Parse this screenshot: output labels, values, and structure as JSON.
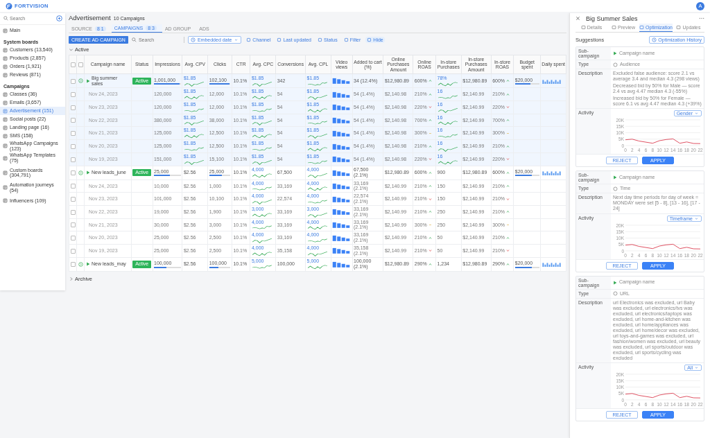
{
  "topbar": {
    "brand": "FORTVISION",
    "avatar": "A"
  },
  "sidebar": {
    "search": {
      "placeholder": "Search"
    },
    "sections": [
      {
        "items": [
          {
            "label": "Main",
            "selected": false
          }
        ]
      },
      {
        "title": "System boards",
        "items": [
          {
            "label": "Customers (13,540)",
            "selected": false
          },
          {
            "label": "Products (2,857)",
            "selected": false
          },
          {
            "label": "Orders (1,921)",
            "selected": false
          },
          {
            "label": "Reviews (871)",
            "selected": false
          }
        ]
      },
      {
        "title": "Campaigns",
        "items": [
          {
            "label": "Classes (36)",
            "selected": false
          },
          {
            "label": "Emails (3,657)",
            "selected": false
          },
          {
            "label": "Advertisement (151)",
            "selected": true
          },
          {
            "label": "Social posts (22)",
            "selected": false
          },
          {
            "label": "Landing page (16)",
            "selected": false
          },
          {
            "label": "SMS (158)",
            "selected": false
          },
          {
            "label": "WhatsApp Campaigns (123)",
            "selected": false
          },
          {
            "label": "WhatsApp Templates (75)",
            "selected": false
          }
        ]
      },
      {
        "items": [
          {
            "label": "Custom boards (304,791)",
            "selected": false
          }
        ]
      },
      {
        "items": [
          {
            "label": "Automation journeys (54)",
            "selected": false
          }
        ]
      },
      {
        "items": [
          {
            "label": "Influencers (109)",
            "selected": false
          }
        ]
      }
    ]
  },
  "header": {
    "title": "Advertisement",
    "count": "10 Campaigns"
  },
  "tabs": [
    {
      "label": "SOURCE",
      "badge": "8 1",
      "selected": false
    },
    {
      "label": "CAMPAIGNS",
      "badge": "8 3",
      "selected": true
    },
    {
      "label": "AD GROUP",
      "selected": false
    },
    {
      "label": "ADS",
      "selected": false
    }
  ],
  "toolbar": {
    "create": "CREATE AD CAMPAIGN",
    "search": {
      "placeholder": "Search"
    },
    "date": "Embedded date",
    "actions": [
      "Channel",
      "Last updated",
      "Status",
      "Filter",
      "Hide"
    ]
  },
  "groups": [
    {
      "label": "Active",
      "expanded": true
    },
    {
      "label": "Archive",
      "expanded": false
    }
  ],
  "table": {
    "header_checks": [
      {
        "checked": false
      },
      {
        "checked": false
      }
    ],
    "columns": [
      "Campaign name",
      "Status",
      "Impressions",
      "Avg. CPV",
      "Clicks",
      "CTR",
      "Avg. CPC",
      "Conversions",
      "Avg. CPL",
      "Video views",
      "Added to cart (%)",
      "Online Purchases Amount",
      "Online ROAS",
      "In-store Purchases",
      "In-store Purchases Amount",
      "In-store ROAS",
      "Budget spent",
      "Daily spent"
    ],
    "rows": [
      {
        "kind": "campaign",
        "selected": true,
        "checked": false,
        "cells": [
          {
            "kind": "name",
            "text": "Big summer sales"
          },
          {
            "kind": "status",
            "text": "Active"
          },
          {
            "kind": "progress",
            "text": "1,001,000",
            "level": 0.95
          },
          {
            "kind": "spark",
            "text": "$1.85"
          },
          {
            "kind": "progress",
            "text": "102,100",
            "level": 0.95
          },
          {
            "kind": "text",
            "text": "10.1%"
          },
          {
            "kind": "spark",
            "text": "$1.85"
          },
          {
            "kind": "text",
            "text": "342"
          },
          {
            "kind": "spark",
            "text": "$1.85"
          },
          {
            "kind": "bars"
          },
          {
            "kind": "text",
            "text": "34 (12.4%)"
          },
          {
            "kind": "text",
            "text": "$12,980.89"
          },
          {
            "kind": "trend_up",
            "text": "600%"
          },
          {
            "kind": "spark",
            "text": "78%"
          },
          {
            "kind": "text",
            "text": "$12,980.89"
          },
          {
            "kind": "trend_up",
            "text": "600%"
          },
          {
            "kind": "budget",
            "text": "$20,000",
            "level": 0.65
          },
          {
            "kind": "daily"
          }
        ]
      },
      {
        "kind": "day",
        "selected": true,
        "checked": false,
        "cells": [
          {
            "kind": "date",
            "text": "Nov 24, 2023"
          },
          {
            "kind": "blank"
          },
          {
            "kind": "text",
            "text": "120,000"
          },
          {
            "kind": "spark",
            "text": "$1.85"
          },
          {
            "kind": "text",
            "text": "12,000"
          },
          {
            "kind": "text",
            "text": "10.1%"
          },
          {
            "kind": "spark",
            "text": "$1.85"
          },
          {
            "kind": "text",
            "text": "54"
          },
          {
            "kind": "spark",
            "text": "$1.85"
          },
          {
            "kind": "bars"
          },
          {
            "kind": "text",
            "text": "54 (1.4%)"
          },
          {
            "kind": "text",
            "text": "$2,140.98"
          },
          {
            "kind": "trend_up",
            "text": "210%"
          },
          {
            "kind": "spark",
            "text": "16"
          },
          {
            "kind": "text",
            "text": "$2,140.99"
          },
          {
            "kind": "trend_up",
            "text": "210%"
          },
          {
            "kind": "blank"
          },
          {
            "kind": "blank"
          }
        ]
      },
      {
        "kind": "day",
        "selected": true,
        "checked": false,
        "cells": [
          {
            "kind": "date",
            "text": "Nov 23, 2023"
          },
          {
            "kind": "blank"
          },
          {
            "kind": "text",
            "text": "120,000"
          },
          {
            "kind": "spark",
            "text": "$1.85"
          },
          {
            "kind": "text",
            "text": "12,000"
          },
          {
            "kind": "text",
            "text": "10.1%"
          },
          {
            "kind": "spark",
            "text": "$1.85"
          },
          {
            "kind": "text",
            "text": "54"
          },
          {
            "kind": "spark",
            "text": "$1.85"
          },
          {
            "kind": "bars"
          },
          {
            "kind": "text",
            "text": "54 (1.4%)"
          },
          {
            "kind": "text",
            "text": "$2,140.98"
          },
          {
            "kind": "trend_down",
            "text": "220%"
          },
          {
            "kind": "spark",
            "text": "16"
          },
          {
            "kind": "text",
            "text": "$2,140.99"
          },
          {
            "kind": "trend_down",
            "text": "220%"
          },
          {
            "kind": "blank"
          },
          {
            "kind": "blank"
          }
        ]
      },
      {
        "kind": "day",
        "selected": true,
        "checked": false,
        "cells": [
          {
            "kind": "date",
            "text": "Nov 22, 2023"
          },
          {
            "kind": "blank"
          },
          {
            "kind": "text",
            "text": "380,000"
          },
          {
            "kind": "spark",
            "text": "$1.85"
          },
          {
            "kind": "text",
            "text": "38,000"
          },
          {
            "kind": "text",
            "text": "10.1%"
          },
          {
            "kind": "spark",
            "text": "$1.85"
          },
          {
            "kind": "text",
            "text": "54"
          },
          {
            "kind": "spark",
            "text": "$1.85"
          },
          {
            "kind": "bars"
          },
          {
            "kind": "text",
            "text": "54 (1.4%)"
          },
          {
            "kind": "text",
            "text": "$2,140.98"
          },
          {
            "kind": "trend_up",
            "text": "700%"
          },
          {
            "kind": "spark",
            "text": "16"
          },
          {
            "kind": "text",
            "text": "$2,140.99"
          },
          {
            "kind": "trend_up",
            "text": "700%"
          },
          {
            "kind": "blank"
          },
          {
            "kind": "blank"
          }
        ]
      },
      {
        "kind": "day",
        "selected": true,
        "checked": false,
        "cells": [
          {
            "kind": "date",
            "text": "Nov 21, 2023"
          },
          {
            "kind": "blank"
          },
          {
            "kind": "text",
            "text": "125,000"
          },
          {
            "kind": "spark",
            "text": "$1.85"
          },
          {
            "kind": "text",
            "text": "12,500"
          },
          {
            "kind": "text",
            "text": "10.1%"
          },
          {
            "kind": "spark",
            "text": "$1.85"
          },
          {
            "kind": "text",
            "text": "54"
          },
          {
            "kind": "spark",
            "text": "$1.85"
          },
          {
            "kind": "bars"
          },
          {
            "kind": "text",
            "text": "54 (1.4%)"
          },
          {
            "kind": "text",
            "text": "$2,140.98"
          },
          {
            "kind": "trend_flat",
            "text": "300%"
          },
          {
            "kind": "spark",
            "text": "16"
          },
          {
            "kind": "text",
            "text": "$2,140.99"
          },
          {
            "kind": "trend_flat",
            "text": "300%"
          },
          {
            "kind": "blank"
          },
          {
            "kind": "blank"
          }
        ]
      },
      {
        "kind": "day",
        "selected": true,
        "checked": false,
        "cells": [
          {
            "kind": "date",
            "text": "Nov 20, 2023"
          },
          {
            "kind": "blank"
          },
          {
            "kind": "text",
            "text": "125,000"
          },
          {
            "kind": "spark",
            "text": "$1.85"
          },
          {
            "kind": "text",
            "text": "12,500"
          },
          {
            "kind": "text",
            "text": "10.1%"
          },
          {
            "kind": "spark",
            "text": "$1.85"
          },
          {
            "kind": "text",
            "text": "54"
          },
          {
            "kind": "spark",
            "text": "$1.85"
          },
          {
            "kind": "bars"
          },
          {
            "kind": "text",
            "text": "54 (1.4%)"
          },
          {
            "kind": "text",
            "text": "$2,140.98"
          },
          {
            "kind": "trend_up",
            "text": "210%"
          },
          {
            "kind": "spark",
            "text": "16"
          },
          {
            "kind": "text",
            "text": "$2,140.99"
          },
          {
            "kind": "trend_up",
            "text": "210%"
          },
          {
            "kind": "blank"
          },
          {
            "kind": "blank"
          }
        ]
      },
      {
        "kind": "day",
        "selected": true,
        "checked": false,
        "cells": [
          {
            "kind": "date",
            "text": "Nov 19, 2023"
          },
          {
            "kind": "blank"
          },
          {
            "kind": "text",
            "text": "151,000"
          },
          {
            "kind": "spark",
            "text": "$1.85"
          },
          {
            "kind": "text",
            "text": "15,100"
          },
          {
            "kind": "text",
            "text": "10.1%"
          },
          {
            "kind": "spark",
            "text": "$1.85"
          },
          {
            "kind": "text",
            "text": "54"
          },
          {
            "kind": "spark",
            "text": "$1.85"
          },
          {
            "kind": "bars"
          },
          {
            "kind": "text",
            "text": "54 (1.4%)"
          },
          {
            "kind": "text",
            "text": "$2,140.98"
          },
          {
            "kind": "trend_down",
            "text": "220%"
          },
          {
            "kind": "spark",
            "text": "16"
          },
          {
            "kind": "text",
            "text": "$2,140.99"
          },
          {
            "kind": "trend_down",
            "text": "220%"
          },
          {
            "kind": "blank"
          },
          {
            "kind": "blank"
          }
        ]
      },
      {
        "kind": "campaign",
        "selected": false,
        "checked": false,
        "cells": [
          {
            "kind": "name",
            "text": "New leads_june"
          },
          {
            "kind": "status",
            "text": "Active"
          },
          {
            "kind": "progress",
            "text": "25,000",
            "level": 0.6
          },
          {
            "kind": "text",
            "text": "$2.56"
          },
          {
            "kind": "progress",
            "text": "25,000",
            "level": 0.6
          },
          {
            "kind": "text",
            "text": "10.1%"
          },
          {
            "kind": "spark",
            "text": "4,000"
          },
          {
            "kind": "text",
            "text": "67,500"
          },
          {
            "kind": "spark",
            "text": "4,000"
          },
          {
            "kind": "bars"
          },
          {
            "kind": "text",
            "text": "67,500 (2.1%)"
          },
          {
            "kind": "text",
            "text": "$12,980.89"
          },
          {
            "kind": "trend_up",
            "text": "600%"
          },
          {
            "kind": "text",
            "text": "900"
          },
          {
            "kind": "text",
            "text": "$12,980.89"
          },
          {
            "kind": "trend_up",
            "text": "600%"
          },
          {
            "kind": "budget",
            "text": "$20,000",
            "level": 0.7
          },
          {
            "kind": "daily"
          }
        ]
      },
      {
        "kind": "day",
        "selected": false,
        "checked": false,
        "cells": [
          {
            "kind": "date",
            "text": "Nov 24, 2023"
          },
          {
            "kind": "blank"
          },
          {
            "kind": "text",
            "text": "10,000"
          },
          {
            "kind": "text",
            "text": "$2.56"
          },
          {
            "kind": "text",
            "text": "1,000"
          },
          {
            "kind": "text",
            "text": "10.1%"
          },
          {
            "kind": "spark",
            "text": "4,000"
          },
          {
            "kind": "text",
            "text": "33,169"
          },
          {
            "kind": "spark",
            "text": "4,000"
          },
          {
            "kind": "bars"
          },
          {
            "kind": "text",
            "text": "33,169 (2.1%)"
          },
          {
            "kind": "text",
            "text": "$2,140.99"
          },
          {
            "kind": "trend_up",
            "text": "210%"
          },
          {
            "kind": "text",
            "text": "150"
          },
          {
            "kind": "text",
            "text": "$2,140.99"
          },
          {
            "kind": "trend_up",
            "text": "210%"
          },
          {
            "kind": "blank"
          },
          {
            "kind": "blank"
          }
        ]
      },
      {
        "kind": "day",
        "selected": false,
        "checked": false,
        "cells": [
          {
            "kind": "date",
            "text": "Nov 23, 2023"
          },
          {
            "kind": "blank"
          },
          {
            "kind": "text",
            "text": "101,000"
          },
          {
            "kind": "text",
            "text": "$2.56"
          },
          {
            "kind": "text",
            "text": "10,100"
          },
          {
            "kind": "text",
            "text": "10.1%"
          },
          {
            "kind": "spark",
            "text": "4,000"
          },
          {
            "kind": "text",
            "text": "22,574"
          },
          {
            "kind": "spark",
            "text": "4,000"
          },
          {
            "kind": "bars"
          },
          {
            "kind": "text",
            "text": "22,574 (2.1%)"
          },
          {
            "kind": "text",
            "text": "$2,140.99"
          },
          {
            "kind": "trend_down",
            "text": "210%"
          },
          {
            "kind": "text",
            "text": "150"
          },
          {
            "kind": "text",
            "text": "$2,140.99"
          },
          {
            "kind": "trend_down",
            "text": "210%"
          },
          {
            "kind": "blank"
          },
          {
            "kind": "blank"
          }
        ]
      },
      {
        "kind": "day",
        "selected": false,
        "checked": false,
        "cells": [
          {
            "kind": "date",
            "text": "Nov 22, 2023"
          },
          {
            "kind": "blank"
          },
          {
            "kind": "text",
            "text": "19,000"
          },
          {
            "kind": "text",
            "text": "$2.56"
          },
          {
            "kind": "text",
            "text": "1,900"
          },
          {
            "kind": "text",
            "text": "10.1%"
          },
          {
            "kind": "spark",
            "text": "3,000"
          },
          {
            "kind": "text",
            "text": "33,169"
          },
          {
            "kind": "spark",
            "text": "3,000"
          },
          {
            "kind": "bars"
          },
          {
            "kind": "text",
            "text": "33,169 (2.1%)"
          },
          {
            "kind": "text",
            "text": "$2,140.99"
          },
          {
            "kind": "trend_up",
            "text": "210%"
          },
          {
            "kind": "text",
            "text": "250"
          },
          {
            "kind": "text",
            "text": "$2,140.99"
          },
          {
            "kind": "trend_up",
            "text": "210%"
          },
          {
            "kind": "blank"
          },
          {
            "kind": "blank"
          }
        ]
      },
      {
        "kind": "day",
        "selected": false,
        "checked": false,
        "cells": [
          {
            "kind": "date",
            "text": "Nov 21, 2023"
          },
          {
            "kind": "blank"
          },
          {
            "kind": "text",
            "text": "30,000"
          },
          {
            "kind": "text",
            "text": "$2.56"
          },
          {
            "kind": "text",
            "text": "3,000"
          },
          {
            "kind": "text",
            "text": "10.1%"
          },
          {
            "kind": "spark",
            "text": "4,000"
          },
          {
            "kind": "text",
            "text": "33,169"
          },
          {
            "kind": "spark",
            "text": "4,000"
          },
          {
            "kind": "bars"
          },
          {
            "kind": "text",
            "text": "33,169 (2.1%)"
          },
          {
            "kind": "text",
            "text": "$2,140.99"
          },
          {
            "kind": "trend_flat",
            "text": "300%"
          },
          {
            "kind": "text",
            "text": "250"
          },
          {
            "kind": "text",
            "text": "$2,140.99"
          },
          {
            "kind": "trend_flat",
            "text": "300%"
          },
          {
            "kind": "blank"
          },
          {
            "kind": "blank"
          }
        ]
      },
      {
        "kind": "day",
        "selected": false,
        "checked": false,
        "cells": [
          {
            "kind": "date",
            "text": "Nov 20, 2023"
          },
          {
            "kind": "blank"
          },
          {
            "kind": "text",
            "text": "25,000"
          },
          {
            "kind": "text",
            "text": "$2.56"
          },
          {
            "kind": "text",
            "text": "2,500"
          },
          {
            "kind": "text",
            "text": "10.1%"
          },
          {
            "kind": "spark",
            "text": "4,000"
          },
          {
            "kind": "text",
            "text": "33,169"
          },
          {
            "kind": "spark",
            "text": "4,000"
          },
          {
            "kind": "bars"
          },
          {
            "kind": "text",
            "text": "33,169 (2.1%)"
          },
          {
            "kind": "text",
            "text": "$2,140.99"
          },
          {
            "kind": "trend_up",
            "text": "210%"
          },
          {
            "kind": "text",
            "text": "50"
          },
          {
            "kind": "text",
            "text": "$2,140.99"
          },
          {
            "kind": "trend_up",
            "text": "210%"
          },
          {
            "kind": "blank"
          },
          {
            "kind": "blank"
          }
        ]
      },
      {
        "kind": "day",
        "selected": false,
        "checked": false,
        "cells": [
          {
            "kind": "date",
            "text": "Nov 19, 2023"
          },
          {
            "kind": "blank"
          },
          {
            "kind": "text",
            "text": "25,000"
          },
          {
            "kind": "text",
            "text": "$2.56"
          },
          {
            "kind": "text",
            "text": "2,500"
          },
          {
            "kind": "text",
            "text": "10.1%"
          },
          {
            "kind": "spark",
            "text": "4,000"
          },
          {
            "kind": "text",
            "text": "35,158"
          },
          {
            "kind": "spark",
            "text": "4,000"
          },
          {
            "kind": "bars"
          },
          {
            "kind": "text",
            "text": "35,158 (2.1%)"
          },
          {
            "kind": "text",
            "text": "$2,140.99"
          },
          {
            "kind": "trend_down",
            "text": "210%"
          },
          {
            "kind": "text",
            "text": "50"
          },
          {
            "kind": "text",
            "text": "$2,140.99"
          },
          {
            "kind": "trend_down",
            "text": "210%"
          },
          {
            "kind": "blank"
          },
          {
            "kind": "blank"
          }
        ]
      },
      {
        "kind": "campaign",
        "selected": false,
        "checked": false,
        "cells": [
          {
            "kind": "name",
            "text": "New leads_may"
          },
          {
            "kind": "status",
            "text": "Active"
          },
          {
            "kind": "progress",
            "text": "100,000",
            "level": 0.45
          },
          {
            "kind": "text",
            "text": "$2.56"
          },
          {
            "kind": "progress",
            "text": "100,000",
            "level": 0.45
          },
          {
            "kind": "text",
            "text": "10.1%"
          },
          {
            "kind": "spark",
            "text": "5,000"
          },
          {
            "kind": "text",
            "text": "100,000"
          },
          {
            "kind": "spark",
            "text": "5,000"
          },
          {
            "kind": "bars"
          },
          {
            "kind": "text",
            "text": "100,000 (2.1%)"
          },
          {
            "kind": "text",
            "text": "$12,980.89"
          },
          {
            "kind": "trend_up",
            "text": "290%"
          },
          {
            "kind": "text",
            "text": "1,234"
          },
          {
            "kind": "text",
            "text": "$12,980.89"
          },
          {
            "kind": "trend_up",
            "text": "290%"
          },
          {
            "kind": "budget",
            "text": "$20,000",
            "level": 0.7
          },
          {
            "kind": "daily"
          }
        ]
      }
    ]
  },
  "panel": {
    "title": "Big Summer Sales",
    "tabs": [
      {
        "label": "Details",
        "selected": false
      },
      {
        "label": "Preview",
        "selected": false
      },
      {
        "label": "Optimization",
        "selected": true
      },
      {
        "label": "Updates",
        "selected": false
      }
    ],
    "heading": "Suggestions",
    "history": "Optimization History",
    "cards": [
      {
        "labels": [
          "Sub-campaign",
          "Type",
          "Description",
          "Activity"
        ],
        "sub": "Campaign name",
        "type": "Audience",
        "description": [
          "Excluded false audience: score 2.1 vs average 3.4 and median 4.3 (298 views)",
          "Decreased bid by 50% for Male — score 2.4 vs avg 4.47 median 4.3 (-55%)",
          "Increased bid by 50% for Female — score 6.1 vs avg 4.47 median 4.3 (+39%)"
        ],
        "filter": "Gender",
        "reject": "REJECT",
        "apply": "APPLY",
        "chart_data": {
          "type": "line",
          "grid": true,
          "x": [
            0,
            2,
            4,
            8,
            10,
            12,
            14,
            16,
            18,
            20,
            22
          ],
          "series": [
            {
              "color": "#e05263",
              "values": [
                4500,
                5000,
                3500,
                1800,
                3800,
                4700,
                5200,
                1800,
                2800,
                1600,
                1500
              ]
            }
          ],
          "xlim": [
            0,
            22
          ],
          "ylim": [
            0,
            20000
          ],
          "xticks": [
            0,
            2,
            4,
            6,
            8,
            10,
            12,
            14,
            16,
            18,
            20,
            22
          ],
          "yticks": [
            {
              "value": 0,
              "label": "0"
            },
            {
              "value": 5000,
              "label": "5K"
            },
            {
              "value": 10000,
              "label": "10K"
            },
            {
              "value": 15000,
              "label": "15K"
            },
            {
              "value": 20000,
              "label": "20K"
            }
          ]
        }
      },
      {
        "labels": [
          "Sub-campaign",
          "Type",
          "Description",
          "Activity"
        ],
        "sub": "Campaign name",
        "type": "Time",
        "description": [
          "Next day time periods for day of week = MONDAY were set [5 - 8], [13 - 16], [17 - 24]"
        ],
        "filter": "Timeframe",
        "reject": "REJECT",
        "apply": "APPLY",
        "chart_data": {
          "type": "line",
          "grid": true,
          "x": [
            0,
            2,
            4,
            8,
            10,
            12,
            14,
            16,
            18,
            20,
            22
          ],
          "series": [
            {
              "color": "#e05263",
              "values": [
                4500,
                5000,
                3500,
                1800,
                3800,
                4700,
                5200,
                1800,
                2800,
                1600,
                1500
              ]
            }
          ],
          "xlim": [
            0,
            22
          ],
          "ylim": [
            0,
            20000
          ],
          "xticks": [
            0,
            2,
            4,
            6,
            8,
            10,
            12,
            14,
            16,
            18,
            20,
            22
          ],
          "yticks": [
            {
              "value": 0,
              "label": "0"
            },
            {
              "value": 5000,
              "label": "5K"
            },
            {
              "value": 10000,
              "label": "10K"
            },
            {
              "value": 15000,
              "label": "15K"
            },
            {
              "value": 20000,
              "label": "20K"
            }
          ]
        }
      },
      {
        "labels": [
          "Sub-campaign",
          "Type",
          "Description",
          "Activity"
        ],
        "sub": "Campaign name",
        "type": "URL",
        "description": [
          "url Electronics was excluded, url Baby was excluded, url electronics/tvs was excluded, url electronics/laptops was excluded, url home-and-kitchen was excluded, url home/appliances was excluded, url home/decor was excluded, url toys-and-games was excluded, url fashion/women was excluded, url beauty was excluded, url sports/outdoor was excluded, url sports/cycling was excluded"
        ],
        "filter": "All",
        "reject": "REJECT",
        "apply": "APPLY",
        "chart_data": {
          "type": "line",
          "grid": true,
          "x": [
            0,
            2,
            4,
            8,
            10,
            12,
            14,
            16,
            18,
            20,
            22
          ],
          "series": [
            {
              "color": "#e05263",
              "values": [
                4500,
                5000,
                3500,
                1800,
                3800,
                4700,
                5200,
                1800,
                2800,
                1600,
                1500
              ]
            }
          ],
          "xlim": [
            0,
            22
          ],
          "ylim": [
            0,
            20000
          ],
          "xticks": [
            0,
            2,
            4,
            6,
            8,
            10,
            12,
            14,
            16,
            18,
            20,
            22
          ],
          "yticks": [
            {
              "value": 0,
              "label": "0"
            },
            {
              "value": 5000,
              "label": "5K"
            },
            {
              "value": 10000,
              "label": "10K"
            },
            {
              "value": 15000,
              "label": "15K"
            },
            {
              "value": 20000,
              "label": "20K"
            }
          ]
        }
      }
    ]
  }
}
